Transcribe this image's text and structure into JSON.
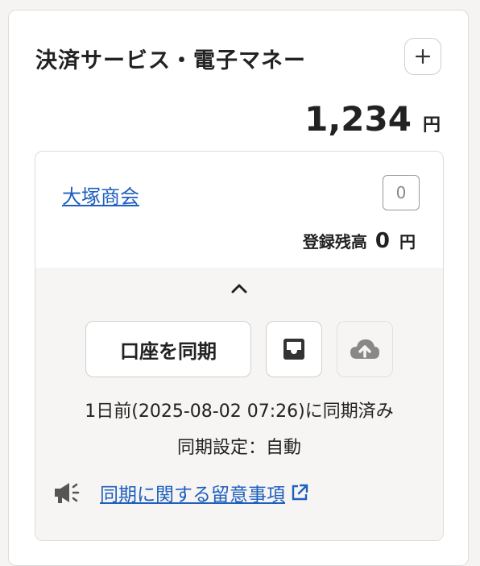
{
  "header": {
    "title": "決済サービス・電子マネー",
    "add_icon": "plus-icon",
    "total_amount": "1,234",
    "total_unit": "円"
  },
  "account": {
    "name": "大塚商会",
    "count": "0",
    "balance_label": "登録残高",
    "balance_amount": "0",
    "balance_unit": "円"
  },
  "panel": {
    "collapse_icon": "chevron-up-icon",
    "sync_button": "口座を同期",
    "inbox_icon": "inbox-icon",
    "cloud_upload_icon": "cloud-upload-icon",
    "sync_status": "1日前(2025-08-02 07:26)に同期済み",
    "sync_setting": "同期設定：自動",
    "notice_icon": "megaphone-icon",
    "notice_link": "同期に関する留意事項",
    "external_link_icon": "external-link-icon"
  },
  "colors": {
    "link": "#1f5fbf",
    "panel_bg": "#f6f5f3",
    "icon_dark": "#333333",
    "icon_muted": "#888888"
  }
}
